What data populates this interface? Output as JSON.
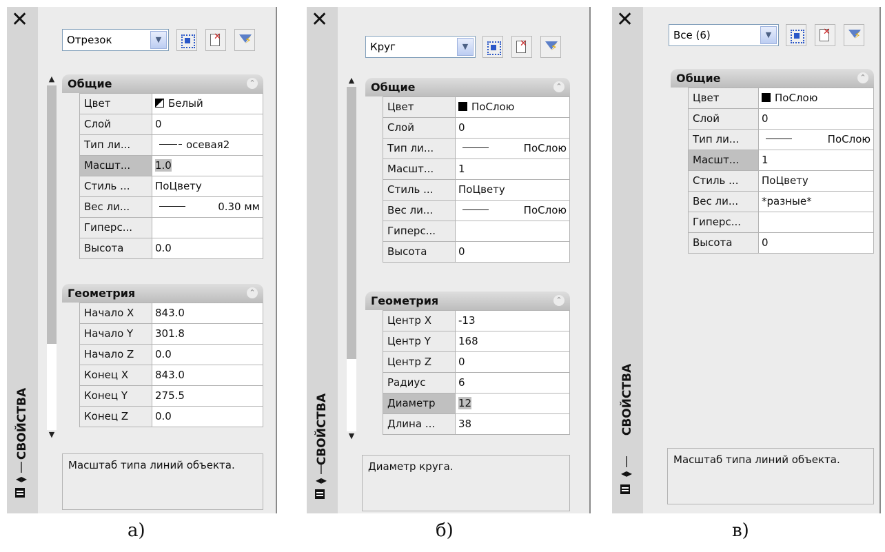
{
  "panels": [
    {
      "close_label": "✕",
      "vertical_title": "СВОЙСТВА",
      "object_selector": "Отрезок",
      "general_section": "Общие",
      "general_rows": [
        {
          "label": "Цвет",
          "value": "Белый"
        },
        {
          "label": "Слой",
          "value": "0"
        },
        {
          "label": "Тип ли...",
          "value": "осевая2"
        },
        {
          "label": "Масшт...",
          "value": "1.0"
        },
        {
          "label": "Стиль ...",
          "value": "ПоЦвету"
        },
        {
          "label": "Вес ли...",
          "value": "0.30 мм"
        },
        {
          "label": "Гиперс...",
          "value": ""
        },
        {
          "label": "Высота",
          "value": "0.0"
        }
      ],
      "geometry_section": "Геометрия",
      "geometry_rows": [
        {
          "label": "Начало X",
          "value": "843.0"
        },
        {
          "label": "Начало Y",
          "value": "301.8"
        },
        {
          "label": "Начало Z",
          "value": "0.0"
        },
        {
          "label": "Конец X",
          "value": "843.0"
        },
        {
          "label": "Конец Y",
          "value": "275.5"
        },
        {
          "label": "Конец Z",
          "value": "0.0"
        }
      ],
      "description": "Масштаб типа линий объекта.",
      "caption": "а)"
    },
    {
      "close_label": "✕",
      "vertical_title": "СВОЙСТВА",
      "object_selector": "Круг",
      "general_section": "Общие",
      "general_rows": [
        {
          "label": "Цвет",
          "value": "ПоСлою"
        },
        {
          "label": "Слой",
          "value": "0"
        },
        {
          "label": "Тип ли...",
          "value": "ПоСлою"
        },
        {
          "label": "Масшт...",
          "value": "1"
        },
        {
          "label": "Стиль ...",
          "value": "ПоЦвету"
        },
        {
          "label": "Вес ли...",
          "value": "ПоСлою"
        },
        {
          "label": "Гиперс...",
          "value": ""
        },
        {
          "label": "Высота",
          "value": "0"
        }
      ],
      "geometry_section": "Геометрия",
      "geometry_rows": [
        {
          "label": "Центр X",
          "value": "-13"
        },
        {
          "label": "Центр Y",
          "value": "168"
        },
        {
          "label": "Центр Z",
          "value": "0"
        },
        {
          "label": "Радиус",
          "value": "6"
        },
        {
          "label": "Диаметр",
          "value": "12"
        },
        {
          "label": "Длина ...",
          "value": "38"
        }
      ],
      "description": "Диаметр круга.",
      "caption": "б)"
    },
    {
      "close_label": "✕",
      "vertical_title": "СВОЙСТВА",
      "object_selector": "Все (6)",
      "general_section": "Общие",
      "general_rows": [
        {
          "label": "Цвет",
          "value": "ПоСлою"
        },
        {
          "label": "Слой",
          "value": "0"
        },
        {
          "label": "Тип ли...",
          "value": "ПоСлою"
        },
        {
          "label": "Масшт...",
          "value": "1"
        },
        {
          "label": "Стиль ...",
          "value": "ПоЦвету"
        },
        {
          "label": "Вес ли...",
          "value": "*разные*"
        },
        {
          "label": "Гиперс...",
          "value": ""
        },
        {
          "label": "Высота",
          "value": "0"
        }
      ],
      "description": "Масштаб типа линий объекта.",
      "caption": "в)"
    }
  ]
}
